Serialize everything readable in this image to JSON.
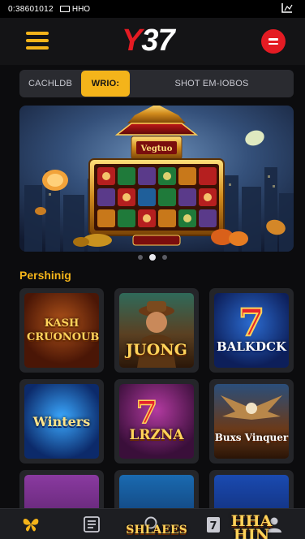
{
  "status_bar": {
    "time": "0:38601012",
    "network_label": "HHO"
  },
  "header": {
    "logo_letter": "Y",
    "logo_number": "37"
  },
  "tabs": [
    {
      "label": "CACHLDB",
      "active": false
    },
    {
      "label": "WRIO:",
      "active": true
    },
    {
      "label": "SHOT EM-IOBOS",
      "active": false
    }
  ],
  "banner": {
    "marquee_text": "Vegtuo",
    "active_slide": 2,
    "slide_count": 3
  },
  "section": {
    "title": "Pershinig"
  },
  "games": [
    {
      "title": "KASH CRUONOUB3"
    },
    {
      "title": "JUONG"
    },
    {
      "title": "BALKDCK"
    },
    {
      "title": "Winters"
    },
    {
      "title": "LRZNA"
    },
    {
      "title": "Buxs Vinquer"
    },
    {
      "title": ""
    },
    {
      "title": "SHLAEES"
    },
    {
      "title": "HHA HIN"
    }
  ],
  "colors": {
    "accent": "#f4b41a",
    "brand_red": "#e41b23",
    "background": "#0c0c0e",
    "card": "#242529"
  },
  "bottom_nav": [
    {
      "icon": "butterfly-icon",
      "active": true
    },
    {
      "icon": "list-icon",
      "active": false
    },
    {
      "icon": "search-icon",
      "active": false
    },
    {
      "icon": "seven-card-icon",
      "active": false
    },
    {
      "icon": "user-icon",
      "active": false
    }
  ]
}
